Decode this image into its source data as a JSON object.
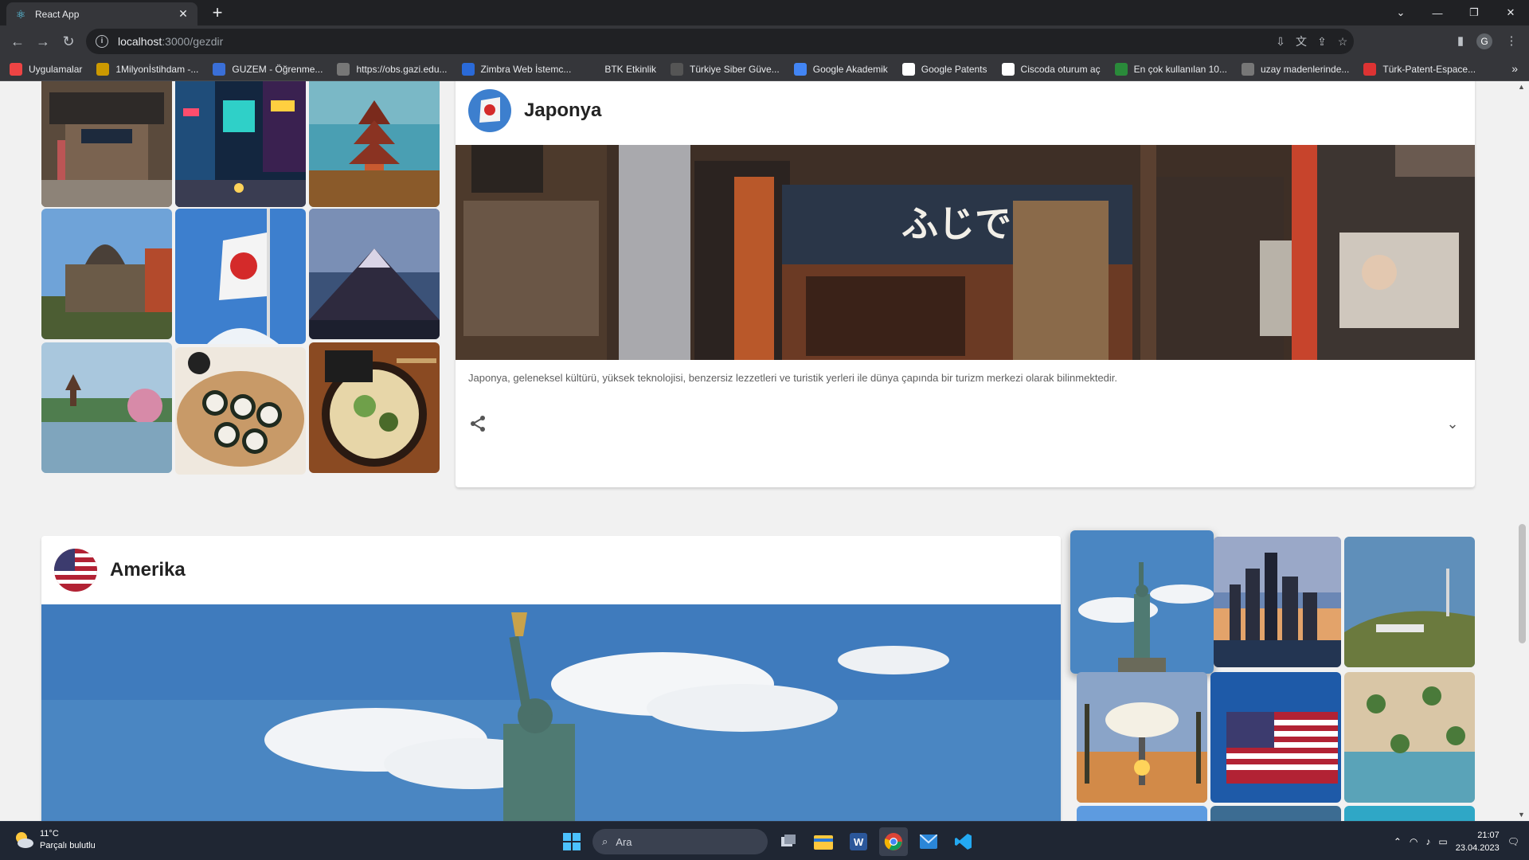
{
  "browser": {
    "tab_title": "React App",
    "url_host": "localhost",
    "url_path": ":3000/gezdir",
    "bookmarks": [
      {
        "label": "Uygulamalar",
        "icon": "apps-grid-icon",
        "color": "#e44"
      },
      {
        "label": "1Milyonİstihdam -...",
        "icon": "dots-icon",
        "color": "#c90"
      },
      {
        "label": "GUZEM - Öğrenme...",
        "icon": "globe-icon",
        "color": "#3a6fd8"
      },
      {
        "label": "https://obs.gazi.edu...",
        "icon": "globe-icon",
        "color": "#777"
      },
      {
        "label": "Zimbra Web İstemc...",
        "icon": "zimbra-icon",
        "color": "#2a6ad8"
      },
      {
        "label": "BTK Etkinlik",
        "icon": "btk-icon",
        "color": "#35363a"
      },
      {
        "label": "Türkiye Siber Güve...",
        "icon": "shield-icon",
        "color": "#555"
      },
      {
        "label": "Google Akademik",
        "icon": "scholar-icon",
        "color": "#4285f4"
      },
      {
        "label": "Google Patents",
        "icon": "google-icon",
        "color": "#fff"
      },
      {
        "label": "Ciscoda oturum aç",
        "icon": "cisco-icon",
        "color": "#fff"
      },
      {
        "label": "En çok kullanılan 10...",
        "icon": "list-icon",
        "color": "#2a8a3a"
      },
      {
        "label": "uzay madenlerinde...",
        "icon": "globe-icon",
        "color": "#777"
      },
      {
        "label": "Türk-Patent-Espace...",
        "icon": "tp-icon",
        "color": "#d33"
      }
    ]
  },
  "japan": {
    "title": "Japonya",
    "description": "Japonya, geleneksel kültürü, yüksek teknolojisi, benzersiz lezzetleri ve turistik yerleri ile dünya çapında bir turizm merkezi olarak bilinmektedir.",
    "gallery": [
      "Tokyo dükkan",
      "Tokyo gece",
      "Pagoda",
      "Hiroşima",
      "Japon bayrağı",
      "Fuji dağı",
      "Tapınak gölü",
      "Suşi",
      "Ramen"
    ]
  },
  "america": {
    "title": "Amerika",
    "gallery": [
      "Özgürlük Heykeli",
      "New York silüeti",
      "Hollywood",
      "Las Vegas",
      "ABD bayrağı",
      "Sahil"
    ]
  },
  "taskbar": {
    "temperature": "11°C",
    "weather_desc": "Parçalı bulutlu",
    "search_label": "Ara",
    "time": "21:07",
    "date": "23.04.2023"
  }
}
